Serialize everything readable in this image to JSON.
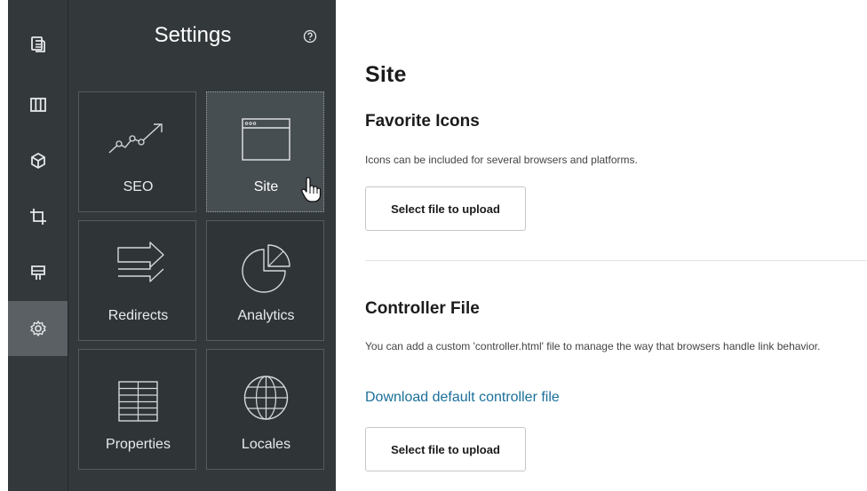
{
  "rail": {
    "items": [
      {
        "name": "pages-icon",
        "active": false
      },
      {
        "name": "layout-icon",
        "active": false
      },
      {
        "name": "components-icon",
        "active": false
      },
      {
        "name": "crop-icon",
        "active": false
      },
      {
        "name": "theme-icon",
        "active": false
      },
      {
        "name": "settings-gear-icon",
        "active": true
      }
    ]
  },
  "settings": {
    "title": "Settings",
    "help_icon": "help-circle-icon",
    "tiles": [
      {
        "label": "SEO",
        "icon": "seo-trend-icon"
      },
      {
        "label": "Site",
        "icon": "browser-window-icon",
        "selected": true
      },
      {
        "label": "Redirects",
        "icon": "redirect-arrows-icon"
      },
      {
        "label": "Analytics",
        "icon": "pie-chart-icon"
      },
      {
        "label": "Properties",
        "icon": "properties-grid-icon"
      },
      {
        "label": "Locales",
        "icon": "globe-icon"
      }
    ]
  },
  "content": {
    "title": "Site",
    "favicons": {
      "heading": "Favorite Icons",
      "description": "Icons can be included for several browsers and platforms.",
      "button_label": "Select file to upload"
    },
    "controller": {
      "heading": "Controller File",
      "description": "You can add a custom 'controller.html' file to manage the way that browsers handle link behavior.",
      "link_label": "Download default controller file",
      "button_label": "Select file to upload"
    }
  },
  "colors": {
    "rail_bg": "#33393b",
    "active_bg": "#5a6064",
    "link": "#1a6f9a"
  }
}
